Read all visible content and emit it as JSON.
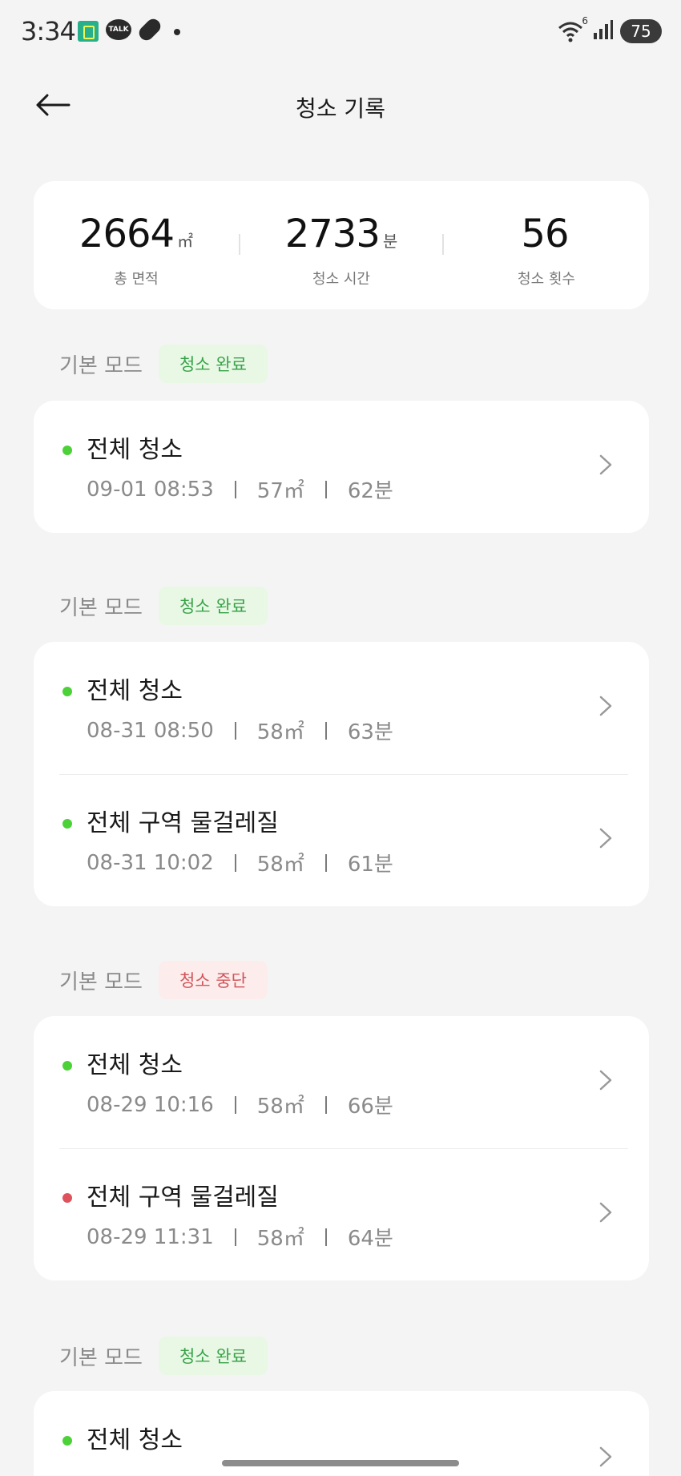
{
  "status_bar": {
    "time": "3:34",
    "talk_label": "TALK",
    "wifi_badge": "6",
    "battery": "75"
  },
  "header": {
    "title": "청소 기록"
  },
  "stats": [
    {
      "value": "2664",
      "unit": "㎡",
      "label": "총 면적"
    },
    {
      "value": "2733",
      "unit": "분",
      "label": "청소 시간"
    },
    {
      "value": "56",
      "unit": "",
      "label": "청소 횟수"
    }
  ],
  "colors": {
    "dot_green": "#4cd138",
    "dot_red": "#e0525b",
    "badge_ok_text": "#38a348",
    "badge_stop_text": "#d1555a"
  },
  "sections": [
    {
      "mode": "기본 모드",
      "status": "청소 완료",
      "status_type": "ok",
      "records": [
        {
          "title": "전체 청소",
          "datetime": "09-01 08:53",
          "area": "57㎡",
          "duration": "62분",
          "dot": "green"
        }
      ]
    },
    {
      "mode": "기본 모드",
      "status": "청소 완료",
      "status_type": "ok",
      "records": [
        {
          "title": "전체 청소",
          "datetime": "08-31 08:50",
          "area": "58㎡",
          "duration": "63분",
          "dot": "green"
        },
        {
          "title": "전체 구역 물걸레질",
          "datetime": "08-31 10:02",
          "area": "58㎡",
          "duration": "61분",
          "dot": "green"
        }
      ]
    },
    {
      "mode": "기본 모드",
      "status": "청소 중단",
      "status_type": "stop",
      "records": [
        {
          "title": "전체 청소",
          "datetime": "08-29 10:16",
          "area": "58㎡",
          "duration": "66분",
          "dot": "green"
        },
        {
          "title": "전체 구역 물걸레질",
          "datetime": "08-29 11:31",
          "area": "58㎡",
          "duration": "64분",
          "dot": "red"
        }
      ]
    },
    {
      "mode": "기본 모드",
      "status": "청소 완료",
      "status_type": "ok",
      "records": [
        {
          "title": "전체 청소",
          "datetime": "",
          "area": "",
          "duration": "",
          "dot": "green"
        }
      ]
    }
  ]
}
